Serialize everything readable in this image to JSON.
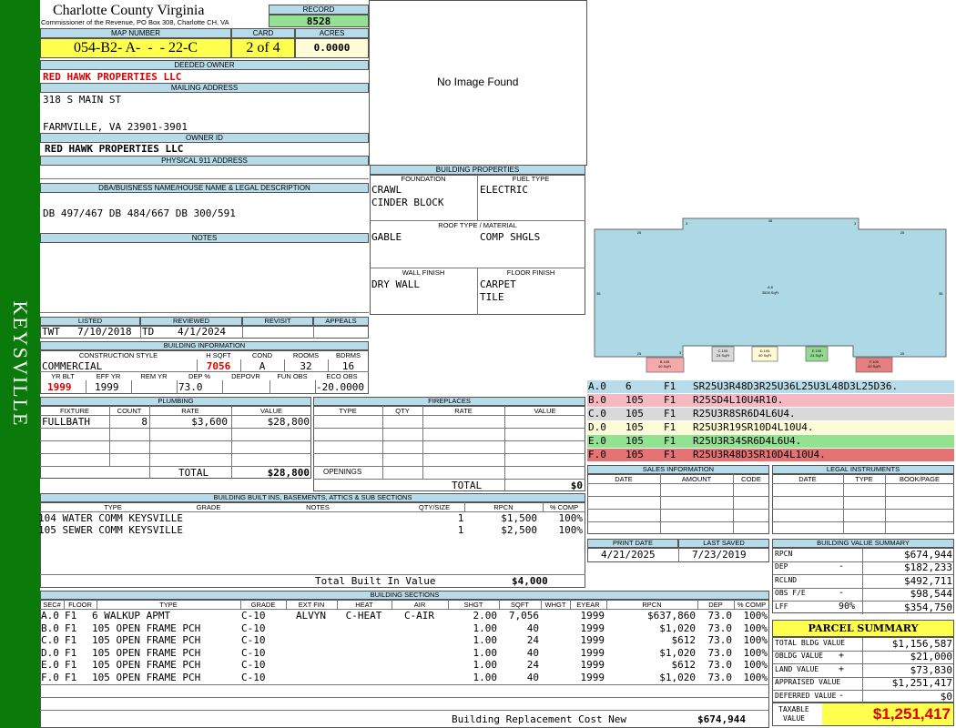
{
  "county": {
    "name": "Charlotte County Virginia",
    "address": "Commissioner of the Revenue, PO Box 308, Charlotte CH, VA",
    "district": "KEYSVILLE"
  },
  "record": {
    "label": "RECORD",
    "value": "8528"
  },
  "map_number": {
    "label": "MAP NUMBER",
    "value": "054-B2- A-  -  - 22-C"
  },
  "card": {
    "label": "CARD",
    "value": "2 of 4"
  },
  "acres": {
    "label": "ACRES",
    "value": "0.0000"
  },
  "owner": {
    "label": "DEEDED OWNER",
    "value": "RED HAWK PROPERTIES LLC"
  },
  "mailing": {
    "label": "MAILING ADDRESS",
    "line1": "318 S MAIN ST",
    "line2": "FARMVILLE, VA 23901-3901"
  },
  "owner_id": {
    "label": "OWNER ID",
    "value": "RED HAWK PROPERTIES LLC"
  },
  "physical": {
    "label": "PHYSICAL 911 ADDRESS",
    "value": ""
  },
  "dba": {
    "label": "DBA/BUISNESS NAME/HOUSE NAME & LEGAL DESCRIPTION",
    "value": "DB 497/467 DB 484/667 DB 300/591"
  },
  "notes": {
    "label": "NOTES",
    "value": ""
  },
  "photo": {
    "text": "No Image Found"
  },
  "listing": {
    "listed_label": "LISTED",
    "reviewed_label": "REVIEWED",
    "revisit_label": "REVISIT",
    "appeals_label": "APPEALS",
    "listed_by": "TWT",
    "listed_date": "7/10/2018",
    "reviewed_by": "TD",
    "reviewed_date": "4/1/2024"
  },
  "building_info": {
    "label": "BUILDING INFORMATION",
    "construction_label": "CONSTRUCTION STYLE",
    "hsqft_label": "H SQFT",
    "cond_label": "COND",
    "rooms_label": "ROOMS",
    "bdrms_label": "BDRMS",
    "construction": "COMMERCIAL",
    "hsqft": "7056",
    "cond": "A",
    "rooms": "32",
    "bdrms": "16",
    "yrblt_label": "YR BLT",
    "effyr_label": "EFF YR",
    "remyr_label": "REM YR",
    "dep_label": "DEP %",
    "depovr_label": "DEPOVR",
    "funobs_label": "FUN OBS",
    "ecoobs_label": "ECO OBS",
    "yrblt": "1999",
    "effyr": "1999",
    "remyr": "",
    "dep": "73.0",
    "depovr": "",
    "funobs": "",
    "ecoobs": "-20.0000"
  },
  "plumbing": {
    "label": "PLUMBING",
    "cols": [
      "FIXTURE",
      "COUNT",
      "RATE",
      "VALUE"
    ],
    "rows": [
      [
        "FULLBATH",
        "8",
        "$3,600",
        "$28,800"
      ]
    ],
    "total_label": "TOTAL",
    "total": "$28,800"
  },
  "fireplaces": {
    "label": "FIREPLACES",
    "cols": [
      "TYPE",
      "QTY",
      "RATE",
      "VALUE"
    ],
    "openings_label": "OPENINGS",
    "total_label": "TOTAL",
    "total": "$0"
  },
  "building_properties": {
    "label": "BUILDING PROPERTIES",
    "foundation_label": "FOUNDATION",
    "fuel_label": "FUEL TYPE",
    "foundation1": "CRAWL",
    "foundation2": "CINDER BLOCK",
    "fuel": "ELECTRIC",
    "roof_label": "ROOF TYPE / MATERIAL",
    "roof_type": "GABLE",
    "roof_material": "COMP SHGLS",
    "wall_label": "WALL FINISH",
    "floor_label": "FLOOR FINISH",
    "wall": "DRY WALL",
    "floor1": "CARPET",
    "floor2": "TILE"
  },
  "sketch": {
    "main_label": "A.6",
    "main_area": "3528 SqFt",
    "sections": [
      {
        "id": "C.105",
        "area": "24 SqFt",
        "color": "#d9d9d9"
      },
      {
        "id": "D.105",
        "area": "40 SqFt",
        "color": "#fff9d6"
      },
      {
        "id": "E.105",
        "area": "24 SqFt",
        "color": "#92d992"
      },
      {
        "id": "B.105",
        "area": "40 SqFt",
        "color": "#f4aaaa"
      },
      {
        "id": "F.105",
        "area": "40 SqFt",
        "color": "#e58080"
      }
    ],
    "dims": [
      "48",
      "25",
      "3",
      "36",
      "36",
      "25",
      "3",
      "25",
      "3",
      "25"
    ]
  },
  "sketch_legend": [
    {
      "sec": "A.0",
      "code": "6",
      "floor": "F1",
      "path": "SR25U3R48D3R25U36L25U3L48D3L25D36.",
      "color": "#b8dbe9"
    },
    {
      "sec": "B.0",
      "code": "105",
      "floor": "F1",
      "path": "R25SD4L10U4R10.",
      "color": "#f6b8c1"
    },
    {
      "sec": "C.0",
      "code": "105",
      "floor": "F1",
      "path": "R25U3R8SR6D4L6U4.",
      "color": "#d9d9d9"
    },
    {
      "sec": "D.0",
      "code": "105",
      "floor": "F1",
      "path": "R25U3R19SR10D4L10U4.",
      "color": "#fffbd6"
    },
    {
      "sec": "E.0",
      "code": "105",
      "floor": "F1",
      "path": "R25U3R34SR6D4L6U4.",
      "color": "#92e292"
    },
    {
      "sec": "F.0",
      "code": "105",
      "floor": "F1",
      "path": "R25U3R48D3SR10D4L10U4.",
      "color": "#e57373"
    }
  ],
  "sales": {
    "label": "SALES INFORMATION",
    "cols": [
      "DATE",
      "AMOUNT",
      "CODE"
    ]
  },
  "legal": {
    "label": "LEGAL INSTRUMENTS",
    "cols": [
      "DATE",
      "TYPE",
      "BOOK/PAGE"
    ]
  },
  "print_date": {
    "label": "PRINT DATE",
    "value": "4/21/2025"
  },
  "last_saved": {
    "label": "LAST SAVED",
    "value": "7/23/2019"
  },
  "builtins": {
    "label": "BUILDING BUILT INS, BASEMENTS, ATTICS & SUB SECTIONS",
    "cols": [
      "TYPE",
      "GRADE",
      "NOTES",
      "QTY/SIZE",
      "RPCN",
      "% COMP"
    ],
    "rows": [
      [
        "104 WATER COMM KEYSVILLE",
        "",
        "",
        "1",
        "$1,500",
        "100%"
      ],
      [
        "105 SEWER COMM KEYSVILLE",
        "",
        "",
        "1",
        "$2,500",
        "100%"
      ]
    ],
    "total_label": "Total Built In Value",
    "total": "$4,000"
  },
  "value_summary": {
    "label": "BUILDING VALUE SUMMARY",
    "rows": [
      {
        "label": "RPCN",
        "sign": "",
        "value": "$674,944"
      },
      {
        "label": "DEP",
        "sign": "-",
        "value": "$182,233"
      },
      {
        "label": "RCLND",
        "sign": "",
        "value": "$492,711"
      },
      {
        "label": "OBS F/E",
        "sign": "-",
        "value": "$98,544"
      },
      {
        "label": "LFF",
        "sign": "90%",
        "value": "$354,750"
      }
    ]
  },
  "parcel_summary": {
    "label": "PARCEL SUMMARY",
    "rows": [
      {
        "label": "TOTAL BLDG VALUE",
        "sign": "",
        "value": "$1,156,587"
      },
      {
        "label": "OBLDG VALUE",
        "sign": "+",
        "value": "$21,000"
      },
      {
        "label": "LAND VALUE",
        "sign": "+",
        "value": "$73,830"
      },
      {
        "label": "APPRAISED VALUE",
        "sign": "",
        "value": "$1,251,417"
      },
      {
        "label": "DEFERRED VALUE",
        "sign": "-",
        "value": "$0"
      }
    ],
    "taxable_label1": "TAXABLE",
    "taxable_label2": "VALUE",
    "taxable": "$1,251,417"
  },
  "sections": {
    "label": "BUILDING SECTIONS",
    "cols": [
      "SEC#",
      "FLOOR",
      "TYPE",
      "GRADE",
      "EXT FIN",
      "HEAT",
      "AIR",
      "SHGT",
      "SQFT",
      "WHGT",
      "EYEAR",
      "RPCN",
      "DEP",
      "% COMP"
    ],
    "rows": [
      [
        "A.0",
        "F1",
        "6 WALKUP APMT",
        "C-10",
        "ALVYN",
        "C-HEAT",
        "C-AIR",
        "2.00",
        "7,056",
        "",
        "1999",
        "$637,860",
        "73.0",
        "100%"
      ],
      [
        "B.0",
        "F1",
        "105 OPEN FRAME PCH",
        "C-10",
        "",
        "",
        "",
        "1.00",
        "40",
        "",
        "1999",
        "$1,020",
        "73.0",
        "100%"
      ],
      [
        "C.0",
        "F1",
        "105 OPEN FRAME PCH",
        "C-10",
        "",
        "",
        "",
        "1.00",
        "24",
        "",
        "1999",
        "$612",
        "73.0",
        "100%"
      ],
      [
        "D.0",
        "F1",
        "105 OPEN FRAME PCH",
        "C-10",
        "",
        "",
        "",
        "1.00",
        "40",
        "",
        "1999",
        "$1,020",
        "73.0",
        "100%"
      ],
      [
        "E.0",
        "F1",
        "105 OPEN FRAME PCH",
        "C-10",
        "",
        "",
        "",
        "1.00",
        "24",
        "",
        "1999",
        "$612",
        "73.0",
        "100%"
      ],
      [
        "F.0",
        "F1",
        "105 OPEN FRAME PCH",
        "C-10",
        "",
        "",
        "",
        "1.00",
        "40",
        "",
        "1999",
        "$1,020",
        "73.0",
        "100%"
      ]
    ],
    "replacement_label": "Building Replacement Cost New",
    "replacement": "$674,944"
  }
}
